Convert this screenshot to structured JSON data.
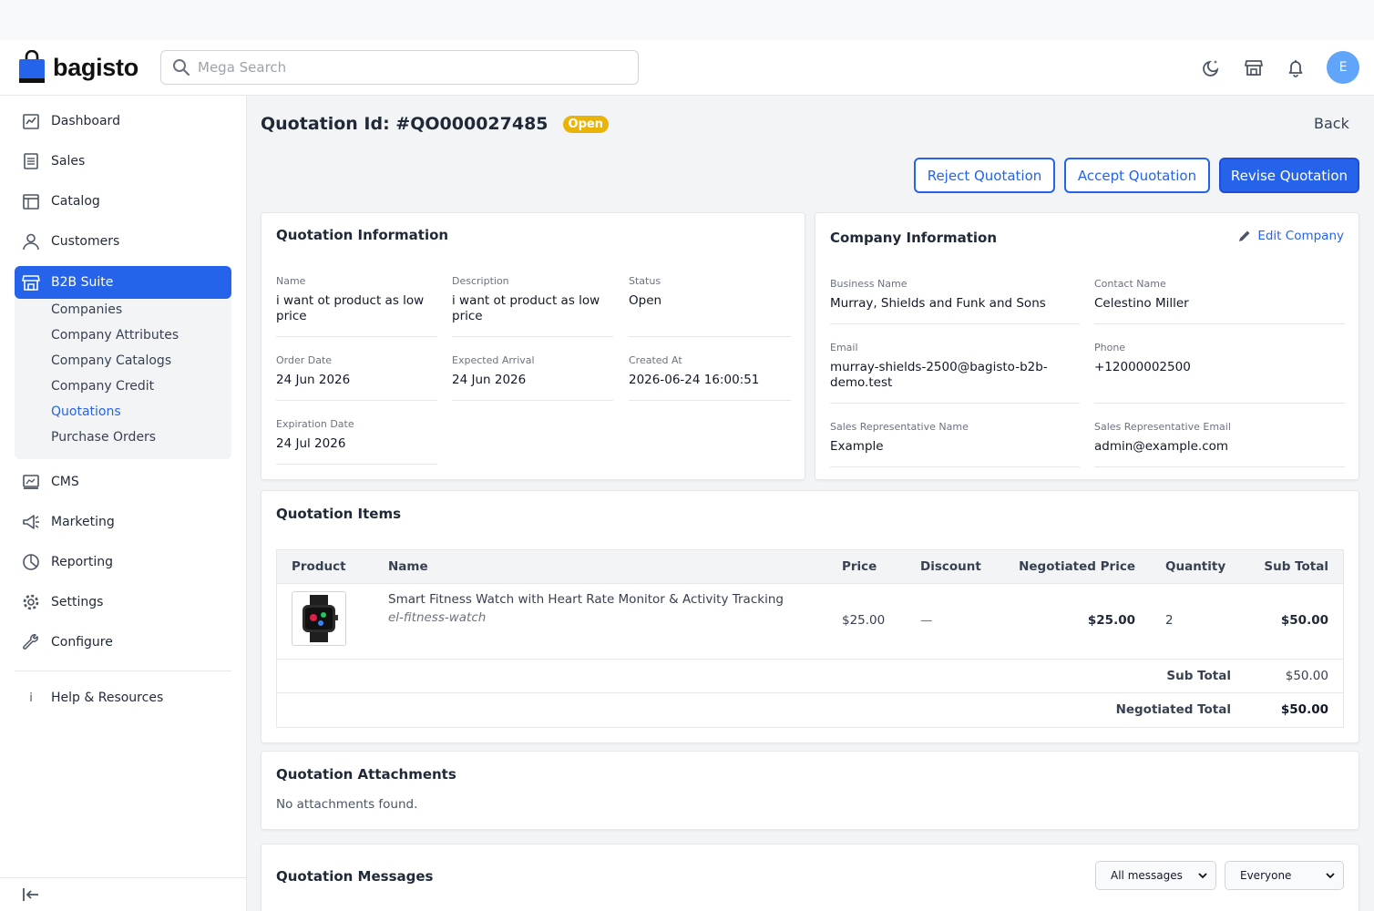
{
  "app": {
    "name": "bagisto"
  },
  "header": {
    "search_placeholder": "Mega Search",
    "avatar_initial": "E"
  },
  "sidebar": {
    "items": [
      {
        "label": "Dashboard"
      },
      {
        "label": "Sales"
      },
      {
        "label": "Catalog"
      },
      {
        "label": "Customers"
      },
      {
        "label": "B2B Suite"
      },
      {
        "label": "CMS"
      },
      {
        "label": "Marketing"
      },
      {
        "label": "Reporting"
      },
      {
        "label": "Settings"
      },
      {
        "label": "Configure"
      }
    ],
    "sub_items": [
      {
        "label": "Companies"
      },
      {
        "label": "Company Attributes"
      },
      {
        "label": "Company Catalogs"
      },
      {
        "label": "Company Credit"
      },
      {
        "label": "Quotations"
      },
      {
        "label": "Purchase Orders"
      }
    ],
    "help": {
      "icon_char": "i",
      "label": "Help & Resources"
    }
  },
  "page": {
    "title": "Quotation Id: #QO000027485",
    "status_badge": "Open",
    "back_label": "Back",
    "actions": {
      "reject": "Reject Quotation",
      "accept": "Accept Quotation",
      "revise": "Revise Quotation"
    }
  },
  "quotation_info": {
    "title": "Quotation Information",
    "fields": {
      "name": {
        "label": "Name",
        "value": "i want ot product as low price"
      },
      "description": {
        "label": "Description",
        "value": "i want ot product as low price"
      },
      "status": {
        "label": "Status",
        "value": "Open"
      },
      "order_date": {
        "label": "Order Date",
        "value": "24 Jun 2026"
      },
      "expected_arrival": {
        "label": "Expected Arrival",
        "value": "24 Jun 2026"
      },
      "created_at": {
        "label": "Created At",
        "value": "2026-06-24 16:00:51"
      },
      "expiration_date": {
        "label": "Expiration Date",
        "value": "24 Jul 2026"
      }
    }
  },
  "company_info": {
    "title": "Company Information",
    "edit_label": "Edit Company",
    "fields": {
      "business_name": {
        "label": "Business Name",
        "value": "Murray, Shields and Funk and Sons"
      },
      "contact_name": {
        "label": "Contact Name",
        "value": "Celestino Miller"
      },
      "email": {
        "label": "Email",
        "value": "murray-shields-2500@bagisto-b2b-demo.test"
      },
      "phone": {
        "label": "Phone",
        "value": "+12000002500"
      },
      "sales_rep_name": {
        "label": "Sales Representative Name",
        "value": "Example"
      },
      "sales_rep_email": {
        "label": "Sales Representative Email",
        "value": "admin@example.com"
      }
    }
  },
  "items": {
    "title": "Quotation Items",
    "columns": {
      "product": "Product",
      "name": "Name",
      "price": "Price",
      "discount": "Discount",
      "negotiated_price": "Negotiated Price",
      "quantity": "Quantity",
      "sub_total": "Sub Total"
    },
    "rows": [
      {
        "name": "Smart Fitness Watch with Heart Rate Monitor & Activity Tracking",
        "sku": "el-fitness-watch",
        "price": "$25.00",
        "discount": "—",
        "negotiated_price": "$25.00",
        "quantity": "2",
        "sub_total": "$50.00"
      }
    ],
    "totals": {
      "sub_total_label": "Sub Total",
      "sub_total_value": "$50.00",
      "negotiated_total_label": "Negotiated Total",
      "negotiated_total_value": "$50.00"
    }
  },
  "attachments": {
    "title": "Quotation Attachments",
    "empty_text": "No attachments found."
  },
  "messages": {
    "title": "Quotation Messages",
    "filter_type": "All messages",
    "filter_audience": "Everyone"
  },
  "colors": {
    "accent": "#2563eb",
    "badge_open": "#eab308",
    "avatar": "#60a5fa"
  }
}
